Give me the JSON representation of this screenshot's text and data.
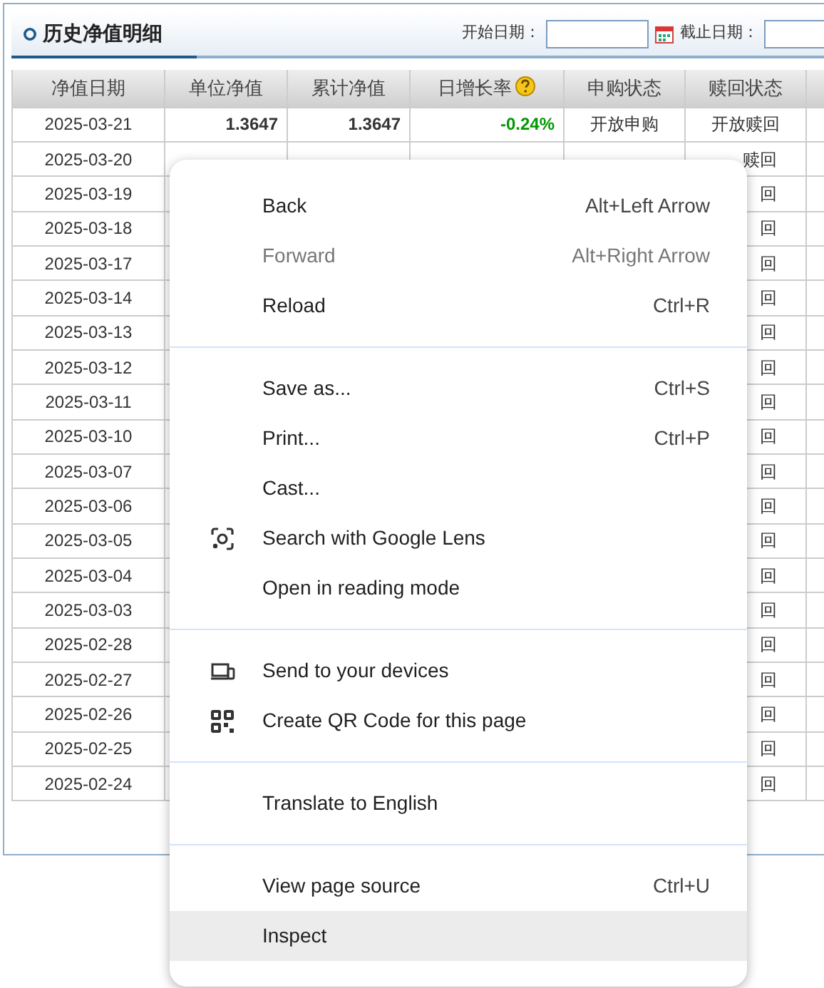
{
  "panel": {
    "title": "历史净值明细",
    "start_label": "开始日期：",
    "end_label": "截止日期："
  },
  "table": {
    "columns": [
      "净值日期",
      "单位净值",
      "累计净值",
      "日增长率",
      "申购状态",
      "赎回状态"
    ],
    "rows": [
      {
        "date": "2025-03-21",
        "unit_nav": "1.3647",
        "acc_nav": "1.3647",
        "change": "-0.24%",
        "purchase": "开放申购",
        "redeem": "开放赎回"
      },
      {
        "date": "2025-03-20",
        "redeem": "赎回"
      },
      {
        "date": "2025-03-19",
        "redeem": "回"
      },
      {
        "date": "2025-03-18",
        "redeem": "回"
      },
      {
        "date": "2025-03-17",
        "redeem": "回"
      },
      {
        "date": "2025-03-14",
        "redeem": "回"
      },
      {
        "date": "2025-03-13",
        "redeem": "回"
      },
      {
        "date": "2025-03-12",
        "redeem": "回"
      },
      {
        "date": "2025-03-11",
        "redeem": "回"
      },
      {
        "date": "2025-03-10",
        "redeem": "回"
      },
      {
        "date": "2025-03-07",
        "redeem": "回"
      },
      {
        "date": "2025-03-06",
        "redeem": "回"
      },
      {
        "date": "2025-03-05",
        "redeem": "回"
      },
      {
        "date": "2025-03-04",
        "redeem": "回"
      },
      {
        "date": "2025-03-03",
        "redeem": "回"
      },
      {
        "date": "2025-02-28",
        "redeem": "回"
      },
      {
        "date": "2025-02-27",
        "redeem": "回"
      },
      {
        "date": "2025-02-26",
        "redeem": "回"
      },
      {
        "date": "2025-02-25",
        "redeem": "回"
      },
      {
        "date": "2025-02-24",
        "redeem": "回"
      }
    ]
  },
  "context_menu": {
    "groups": [
      [
        {
          "kind": "plain",
          "label": "Back",
          "shortcut": "Alt+Left Arrow",
          "disabled": false,
          "highlighted": false
        },
        {
          "kind": "plain",
          "label": "Forward",
          "shortcut": "Alt+Right Arrow",
          "disabled": true,
          "highlighted": false
        },
        {
          "kind": "plain",
          "label": "Reload",
          "shortcut": "Ctrl+R",
          "disabled": false,
          "highlighted": false
        }
      ],
      [
        {
          "kind": "plain",
          "label": "Save as...",
          "shortcut": "Ctrl+S",
          "disabled": false,
          "highlighted": false
        },
        {
          "kind": "plain",
          "label": "Print...",
          "shortcut": "Ctrl+P",
          "disabled": false,
          "highlighted": false
        },
        {
          "kind": "plain",
          "label": "Cast...",
          "disabled": false,
          "highlighted": false
        },
        {
          "kind": "lens",
          "label": "Search with Google Lens",
          "disabled": false,
          "highlighted": false
        },
        {
          "kind": "plain",
          "label": "Open in reading mode",
          "disabled": false,
          "highlighted": false
        }
      ],
      [
        {
          "kind": "devices",
          "label": "Send to your devices",
          "disabled": false,
          "highlighted": false
        },
        {
          "kind": "qr",
          "label": "Create QR Code for this page",
          "disabled": false,
          "highlighted": false
        }
      ],
      [
        {
          "kind": "plain",
          "label": "Translate to English",
          "disabled": false,
          "highlighted": false
        }
      ],
      [
        {
          "kind": "plain",
          "label": "View page source",
          "shortcut": "Ctrl+U",
          "disabled": false,
          "highlighted": false
        },
        {
          "kind": "plain",
          "label": "Inspect",
          "disabled": false,
          "highlighted": true
        }
      ]
    ]
  }
}
